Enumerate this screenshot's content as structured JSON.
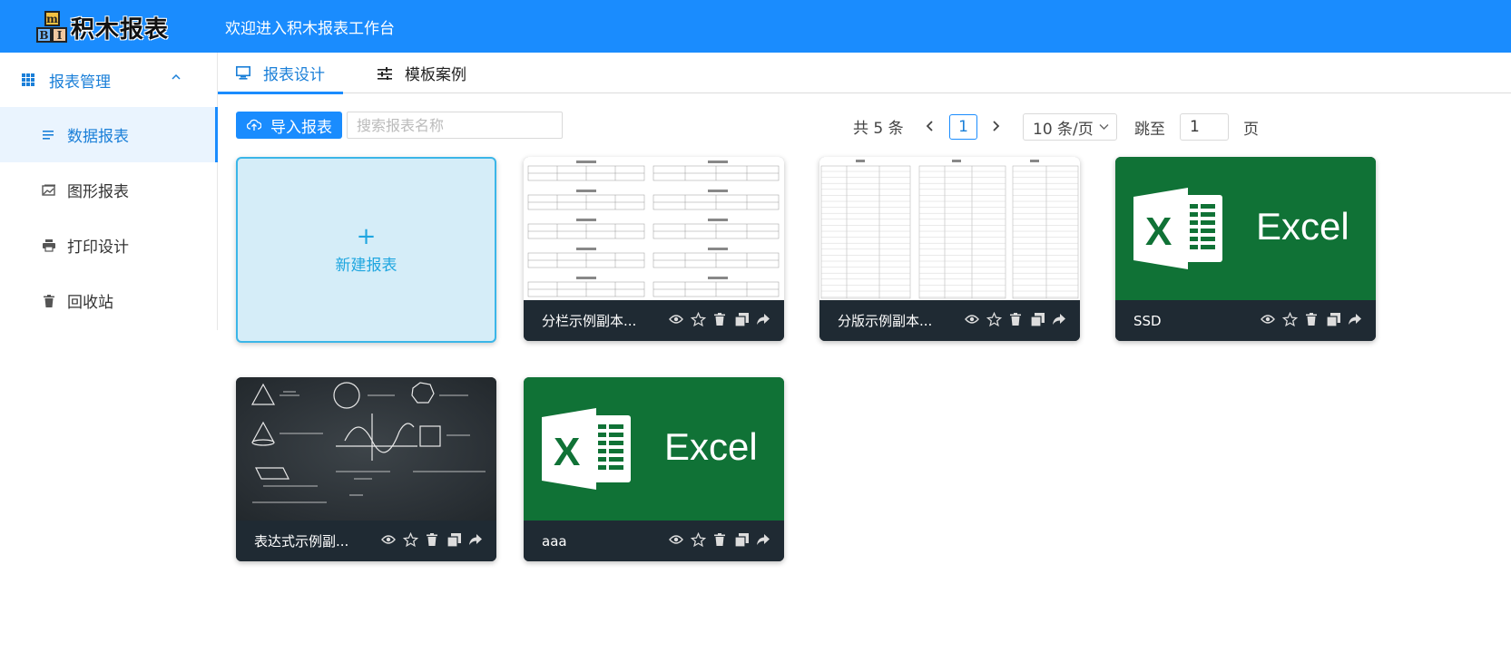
{
  "header": {
    "logo_text": "积木报表",
    "logo_letters": [
      "m",
      "B",
      "I"
    ],
    "title": "欢迎进入积木报表工作台",
    "bg_color": "#1a8cfe"
  },
  "sidebar": {
    "group_label": "报表管理",
    "items": [
      {
        "label": "数据报表",
        "icon": "list-icon",
        "active": true
      },
      {
        "label": "图形报表",
        "icon": "image-icon",
        "active": false
      },
      {
        "label": "打印设计",
        "icon": "printer-icon",
        "active": false
      },
      {
        "label": "回收站",
        "icon": "trash-icon",
        "active": false
      }
    ]
  },
  "tabs": [
    {
      "label": "报表设计",
      "icon": "monitor-icon",
      "active": true
    },
    {
      "label": "模板案例",
      "icon": "sliders-icon",
      "active": false
    }
  ],
  "toolbar": {
    "import_label": "导入报表",
    "search_placeholder": "搜索报表名称",
    "search_value": ""
  },
  "pagination": {
    "total_text": "共 5 条",
    "current_page": "1",
    "page_size": "10 条/页",
    "jump_label": "跳至",
    "jump_value": "1",
    "page_suffix": "页"
  },
  "new_card": {
    "plus": "+",
    "label": "新建报表"
  },
  "cards": [
    {
      "name": "分栏示例副本...",
      "thumb": "column-sheet"
    },
    {
      "name": "分版示例副本...",
      "thumb": "table-sheet"
    },
    {
      "name": "SSD",
      "thumb": "excel-logo"
    },
    {
      "name": "表达式示例副...",
      "thumb": "chalkboard"
    },
    {
      "name": "aaa",
      "thumb": "excel-logo"
    }
  ],
  "excel_word": "Excel",
  "excel_letter": "X",
  "card_actions": [
    "eye-icon",
    "star-icon",
    "trash-icon",
    "copy-icon",
    "share-icon"
  ]
}
